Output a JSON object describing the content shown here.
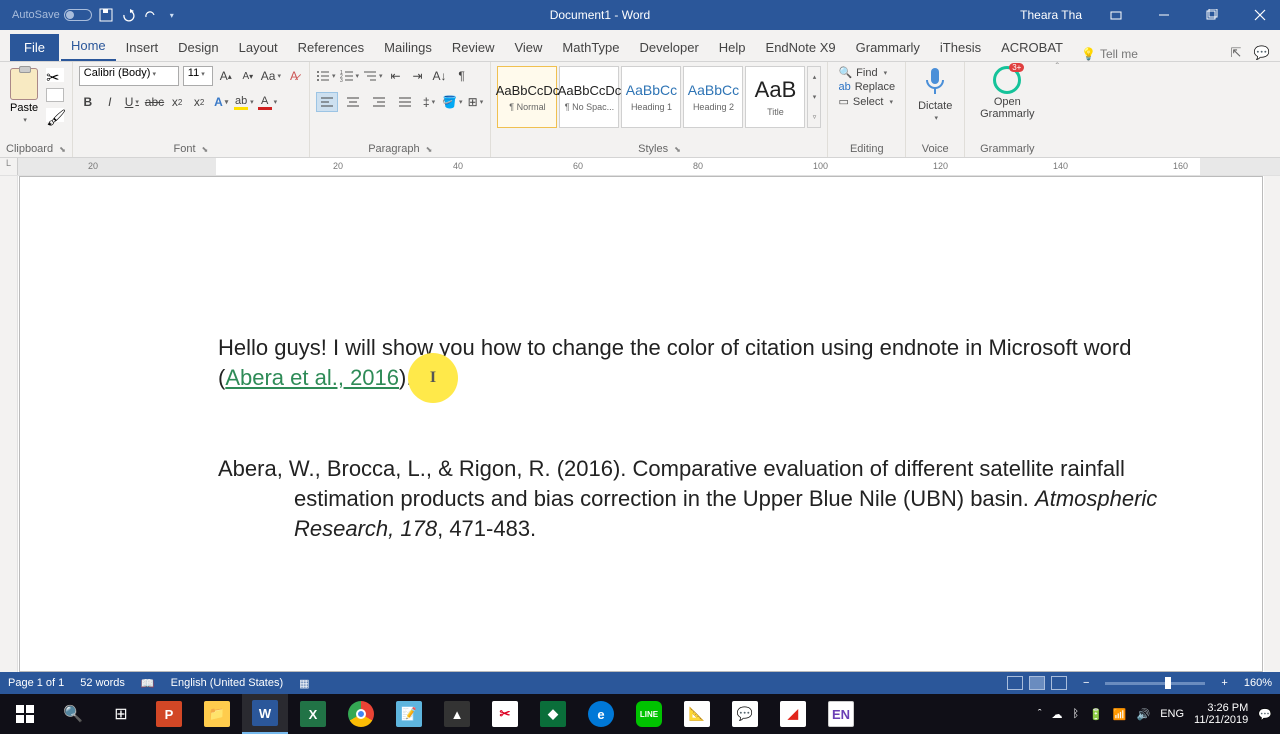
{
  "titlebar": {
    "autosave": "AutoSave",
    "title": "Document1 - Word",
    "user": "Theara Tha"
  },
  "tabs": {
    "file": "File",
    "list": [
      "Home",
      "Insert",
      "Design",
      "Layout",
      "References",
      "Mailings",
      "Review",
      "View",
      "MathType",
      "Developer",
      "Help",
      "EndNote X9",
      "Grammarly",
      "iThesis",
      "ACROBAT"
    ],
    "active": "Home",
    "tellme": "Tell me"
  },
  "ribbon": {
    "clipboard": {
      "paste": "Paste",
      "label": "Clipboard"
    },
    "font": {
      "name": "Calibri (Body)",
      "size": "11",
      "label": "Font"
    },
    "paragraph": {
      "label": "Paragraph"
    },
    "styles": {
      "label": "Styles",
      "items": [
        {
          "sample": "AaBbCcDc",
          "name": "¶ Normal"
        },
        {
          "sample": "AaBbCcDc",
          "name": "¶ No Spac..."
        },
        {
          "sample": "AaBbCc",
          "name": "Heading 1"
        },
        {
          "sample": "AaBbCc",
          "name": "Heading 2"
        },
        {
          "sample": "AaB",
          "name": "Title"
        }
      ]
    },
    "editing": {
      "find": "Find",
      "replace": "Replace",
      "select": "Select",
      "label": "Editing"
    },
    "voice": {
      "dictate": "Dictate",
      "label": "Voice"
    },
    "grammarly": {
      "open": "Open Grammarly",
      "label": "Grammarly",
      "badge": "3+"
    }
  },
  "ruler": {
    "ticks": [
      "20",
      "20",
      "40",
      "60",
      "80",
      "100",
      "120",
      "140",
      "160"
    ]
  },
  "document": {
    "para1_pre": "Hello guys! I will show you how to change the color of citation using endnote in Microsoft word (",
    "para1_cite": "Abera et al., 2016",
    "para1_post": ").",
    "ref_a": "Abera, W., Brocca, L., & Rigon, R. (2016). Comparative evaluation of different satellite rainfall estimation products and bias correction in the Upper Blue Nile (UBN) basin. ",
    "ref_i": "Atmospheric Research, 178",
    "ref_b": ", 471-483."
  },
  "status": {
    "page": "Page 1 of 1",
    "words": "52 words",
    "lang": "English (United States)",
    "zoom": "160%"
  },
  "tray": {
    "lang": "ENG",
    "time": "3:26 PM",
    "date": "11/21/2019"
  }
}
